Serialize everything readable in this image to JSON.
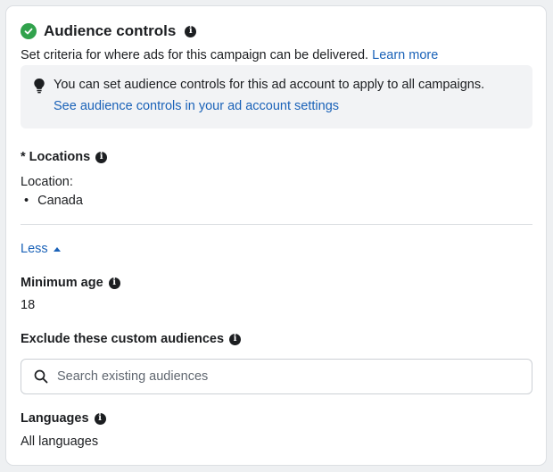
{
  "header": {
    "title": "Audience controls",
    "info_icon": "i"
  },
  "description": {
    "text": "Set criteria for where ads for this campaign can be delivered.",
    "link": "Learn more"
  },
  "tip": {
    "icon": "lightbulb-icon",
    "text": "You can set audience controls for this ad account to apply to all campaigns.",
    "link": "See audience controls in your ad account settings"
  },
  "locations": {
    "label": "* Locations",
    "sub_label": "Location:",
    "items": [
      "Canada"
    ],
    "bullet": "•"
  },
  "toggle": {
    "label": "Less"
  },
  "minimum_age": {
    "label": "Minimum age",
    "value": "18"
  },
  "exclude": {
    "label": "Exclude these custom audiences",
    "placeholder": "Search existing audiences"
  },
  "languages": {
    "label": "Languages",
    "value": "All languages"
  },
  "colors": {
    "accent_link": "#1a62b8",
    "success": "#31a24c",
    "tip_background": "#f2f3f5"
  }
}
